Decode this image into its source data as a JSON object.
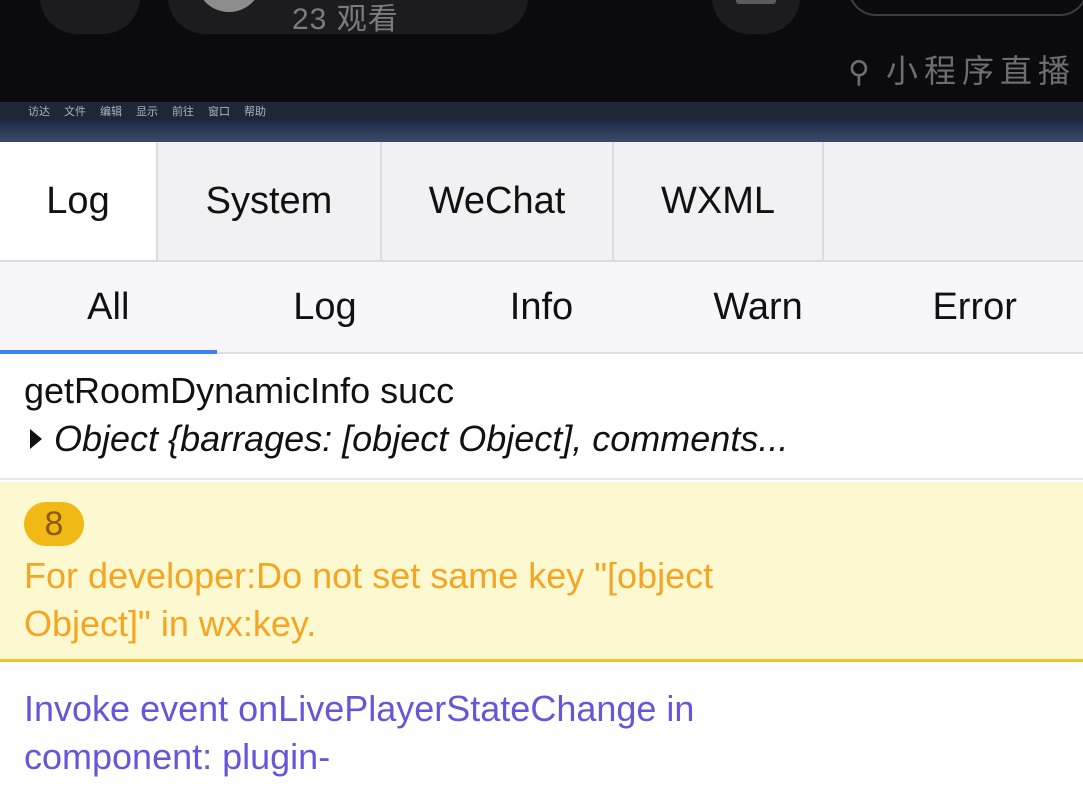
{
  "live_overlay": {
    "viewers_text": "23 观看",
    "mini_program_live_label": "小程序直播",
    "link_icon": "link-icon"
  },
  "menubar": {
    "apple_icon": "apple-logo-icon",
    "items": [
      "访达",
      "文件",
      "编辑",
      "显示",
      "前往",
      "窗口",
      "帮助"
    ]
  },
  "tabs": {
    "items": [
      "Log",
      "System",
      "WeChat",
      "WXML"
    ],
    "active": "Log"
  },
  "filters": {
    "items": [
      "All",
      "Log",
      "Info",
      "Warn",
      "Error"
    ],
    "active": "All",
    "accent_color": "#3b82f6"
  },
  "entries": [
    {
      "level": "log",
      "title": "getRoomDynamicInfo succ",
      "object_preview": "Object {barrages: [object Object], comments..."
    },
    {
      "level": "warn",
      "count": "8",
      "message": "For developer:Do not set same key \"[object Object]\" in wx:key.",
      "color": "#f5a524",
      "background": "#fcf8cf"
    },
    {
      "level": "info",
      "message": "Invoke event onLivePlayerStateChange in component: plugin-",
      "color": "#6a55d8"
    }
  ]
}
